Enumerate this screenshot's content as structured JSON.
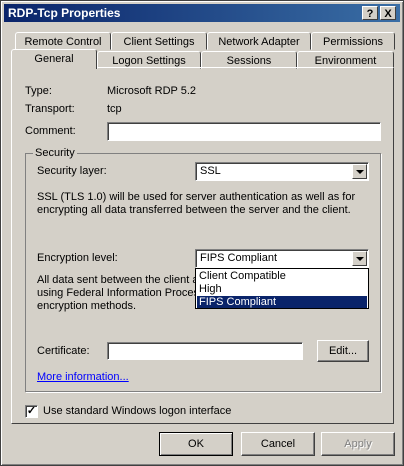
{
  "window": {
    "title": "RDP-Tcp Properties",
    "help_button": "?",
    "close_button": "X"
  },
  "tabs": {
    "row1": [
      "Remote Control",
      "Client Settings",
      "Network Adapter",
      "Permissions"
    ],
    "row2": [
      "General",
      "Logon Settings",
      "Sessions",
      "Environment"
    ],
    "active": "General"
  },
  "general": {
    "type_label": "Type:",
    "type_value": "Microsoft RDP 5.2",
    "transport_label": "Transport:",
    "transport_value": "tcp",
    "comment_label": "Comment:",
    "comment_value": ""
  },
  "security": {
    "group_label": "Security",
    "layer_label": "Security layer:",
    "layer_value": "SSL",
    "layer_desc_line1": "SSL (TLS 1.0) will be used for server authentication as well as for",
    "layer_desc_line2": "encrypting all data transferred between the server and the client.",
    "encryption_label": "Encryption level:",
    "encryption_value": "FIPS Compliant",
    "encryption_desc_line1": "All data sent between the client a",
    "encryption_desc_line2": "using Federal Information Process",
    "encryption_desc_line3": "encryption methods.",
    "encryption_options": [
      "Client Compatible",
      "High",
      "FIPS Compliant"
    ],
    "selected_option": "FIPS Compliant",
    "certificate_label": "Certificate:",
    "certificate_value": "",
    "edit_button": "Edit...",
    "more_info_link": "More information..."
  },
  "logon": {
    "checkbox_label": "Use standard Windows logon interface",
    "checked": true
  },
  "buttons": {
    "ok": "OK",
    "cancel": "Cancel",
    "apply": "Apply"
  },
  "colors": {
    "titlebar": "#0a246a",
    "face": "#d4d0c8",
    "selection": "#0a246a",
    "link": "#0000ff"
  }
}
